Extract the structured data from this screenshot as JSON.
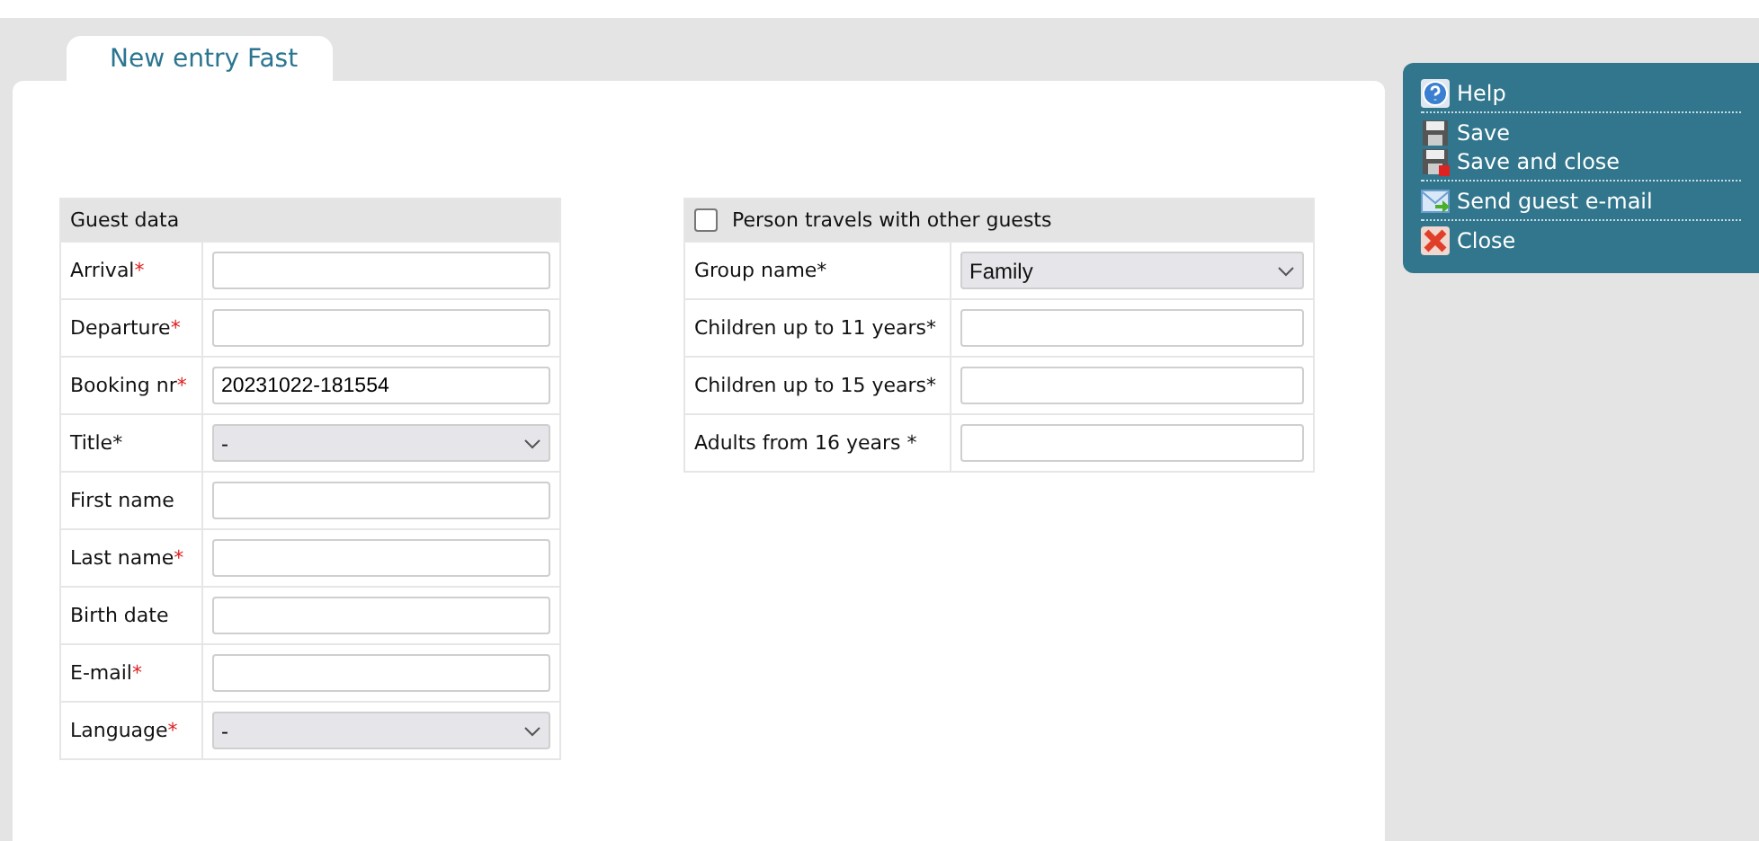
{
  "tab": {
    "label": "New entry Fast",
    "selected": true
  },
  "guest_data": {
    "title": "Guest data",
    "rows": [
      {
        "label": "Arrival",
        "required_mark": "*",
        "kind": "text"
      },
      {
        "label": "Departure",
        "required_mark": "*",
        "kind": "text"
      },
      {
        "label": "Booking nr",
        "required_mark": "*",
        "kind": "text",
        "value": "20231022-181554"
      },
      {
        "label": "Title*",
        "kind": "select",
        "value": "-"
      },
      {
        "label": "First name",
        "kind": "text"
      },
      {
        "label": "Last name",
        "required_mark": "*",
        "kind": "text"
      },
      {
        "label": "Birth date",
        "kind": "text"
      },
      {
        "label": "E-mail",
        "required_mark": "*",
        "kind": "text"
      },
      {
        "label": "Language",
        "required_mark": "*",
        "kind": "select",
        "value": "-"
      }
    ]
  },
  "group": {
    "checkbox": {
      "label": "Person travels with other guests",
      "checked": false
    },
    "rows": [
      {
        "label": "Group name*",
        "kind": "select",
        "value": "Family"
      },
      {
        "label": "Children up to 11 years*",
        "kind": "text"
      },
      {
        "label": "Children up to 15 years*",
        "kind": "text"
      },
      {
        "label": "Adults from 16 years *",
        "kind": "text"
      }
    ]
  },
  "actions": [
    [
      {
        "label": "Help",
        "kind": "help"
      }
    ],
    [
      {
        "label": "Save",
        "kind": "save"
      },
      {
        "label": "Save and close",
        "kind": "save_close"
      }
    ],
    [
      {
        "label": "Send guest e-mail",
        "kind": "mail"
      }
    ],
    [
      {
        "label": "Close",
        "kind": "close"
      }
    ]
  ]
}
